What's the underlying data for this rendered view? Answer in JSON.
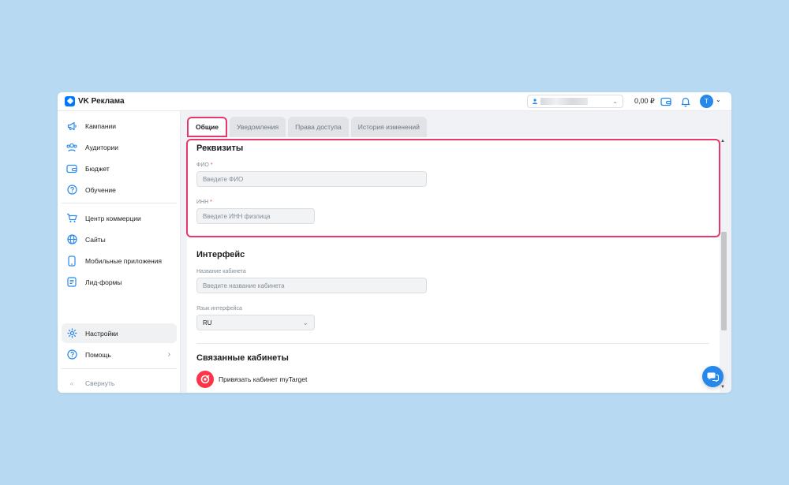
{
  "app": {
    "logo_text": "VK Реклама",
    "brand_color": "#0077ff",
    "accent_color": "#2688eb",
    "highlight_color": "#e8386b"
  },
  "header": {
    "balance": "0,00 ₽",
    "avatar_letter": "T",
    "icons": [
      "wallet-icon",
      "bell-icon"
    ]
  },
  "sidebar": {
    "items": [
      {
        "label": "Кампании",
        "icon": "megaphone-icon"
      },
      {
        "label": "Аудитории",
        "icon": "users-icon"
      },
      {
        "label": "Бюджет",
        "icon": "wallet-icon"
      },
      {
        "label": "Обучение",
        "icon": "question-icon"
      },
      {
        "label": "Центр коммерции",
        "icon": "cart-icon"
      },
      {
        "label": "Сайты",
        "icon": "globe-icon"
      },
      {
        "label": "Мобильные приложения",
        "icon": "phone-icon"
      },
      {
        "label": "Лид-формы",
        "icon": "form-icon"
      }
    ],
    "settings_label": "Настройки",
    "help_label": "Помощь",
    "collapse_label": "Свернуть"
  },
  "tabs": [
    {
      "label": "Общие",
      "active": true
    },
    {
      "label": "Уведомления",
      "active": false
    },
    {
      "label": "Права доступа",
      "active": false
    },
    {
      "label": "История изменений",
      "active": false
    }
  ],
  "requisites": {
    "title": "Реквизиты",
    "fio_label": "ФИО",
    "fio_placeholder": "Введите ФИО",
    "inn_label": "ИНН",
    "inn_placeholder": "Введите ИНН физлица",
    "required_mark": "*"
  },
  "interface": {
    "title": "Интерфейс",
    "cabinet_name_label": "Название кабинета",
    "cabinet_name_placeholder": "Введите название кабинета",
    "language_label": "Язык интерфейса",
    "language_value": "RU"
  },
  "linked": {
    "title": "Связанные кабинеты",
    "mytarget_label": "Привязать кабинет myTarget"
  }
}
